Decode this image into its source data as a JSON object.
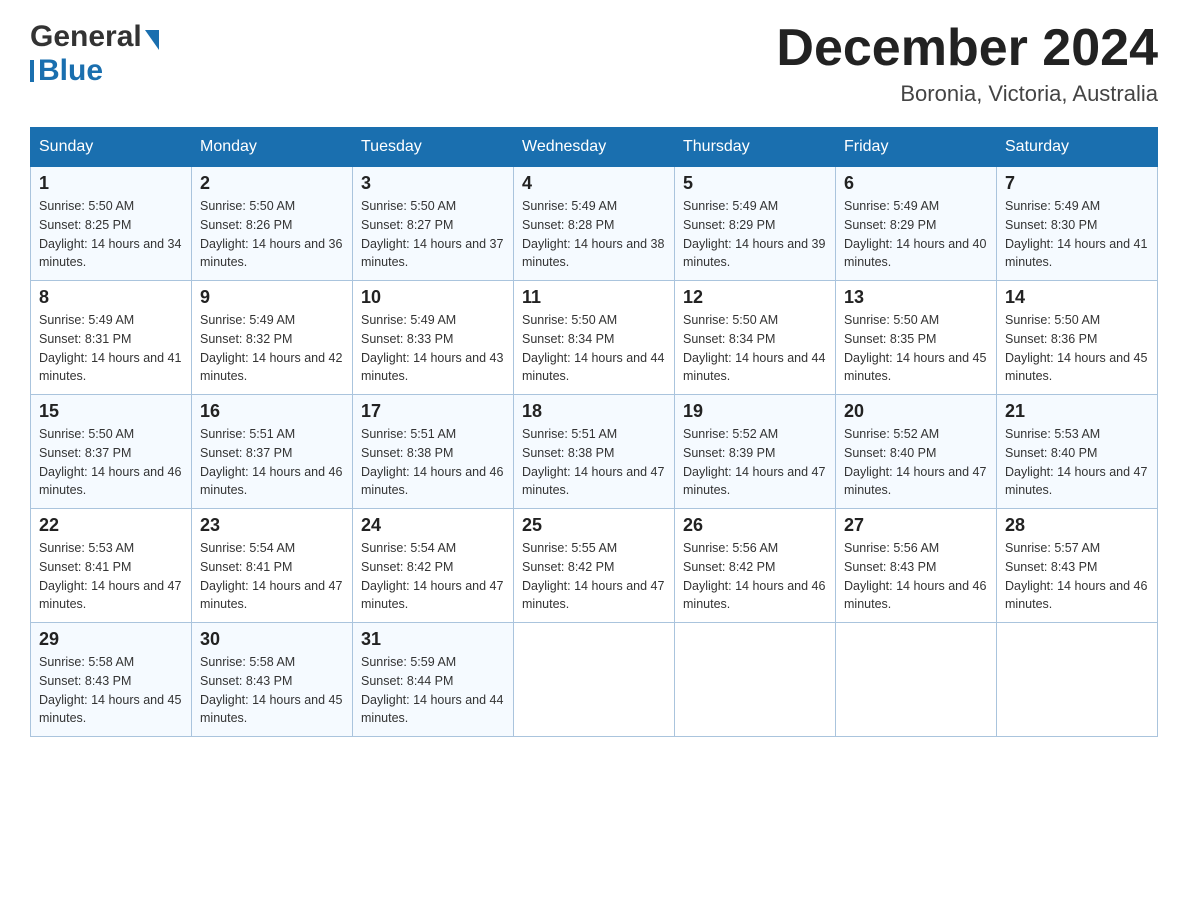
{
  "logo": {
    "text_general": "General",
    "text_blue": "Blue",
    "triangle_color": "#1a6faf"
  },
  "header": {
    "month_year": "December 2024",
    "location": "Boronia, Victoria, Australia"
  },
  "weekdays": [
    "Sunday",
    "Monday",
    "Tuesday",
    "Wednesday",
    "Thursday",
    "Friday",
    "Saturday"
  ],
  "weeks": [
    [
      {
        "day": "1",
        "sunrise": "5:50 AM",
        "sunset": "8:25 PM",
        "daylight": "14 hours and 34 minutes."
      },
      {
        "day": "2",
        "sunrise": "5:50 AM",
        "sunset": "8:26 PM",
        "daylight": "14 hours and 36 minutes."
      },
      {
        "day": "3",
        "sunrise": "5:50 AM",
        "sunset": "8:27 PM",
        "daylight": "14 hours and 37 minutes."
      },
      {
        "day": "4",
        "sunrise": "5:49 AM",
        "sunset": "8:28 PM",
        "daylight": "14 hours and 38 minutes."
      },
      {
        "day": "5",
        "sunrise": "5:49 AM",
        "sunset": "8:29 PM",
        "daylight": "14 hours and 39 minutes."
      },
      {
        "day": "6",
        "sunrise": "5:49 AM",
        "sunset": "8:29 PM",
        "daylight": "14 hours and 40 minutes."
      },
      {
        "day": "7",
        "sunrise": "5:49 AM",
        "sunset": "8:30 PM",
        "daylight": "14 hours and 41 minutes."
      }
    ],
    [
      {
        "day": "8",
        "sunrise": "5:49 AM",
        "sunset": "8:31 PM",
        "daylight": "14 hours and 41 minutes."
      },
      {
        "day": "9",
        "sunrise": "5:49 AM",
        "sunset": "8:32 PM",
        "daylight": "14 hours and 42 minutes."
      },
      {
        "day": "10",
        "sunrise": "5:49 AM",
        "sunset": "8:33 PM",
        "daylight": "14 hours and 43 minutes."
      },
      {
        "day": "11",
        "sunrise": "5:50 AM",
        "sunset": "8:34 PM",
        "daylight": "14 hours and 44 minutes."
      },
      {
        "day": "12",
        "sunrise": "5:50 AM",
        "sunset": "8:34 PM",
        "daylight": "14 hours and 44 minutes."
      },
      {
        "day": "13",
        "sunrise": "5:50 AM",
        "sunset": "8:35 PM",
        "daylight": "14 hours and 45 minutes."
      },
      {
        "day": "14",
        "sunrise": "5:50 AM",
        "sunset": "8:36 PM",
        "daylight": "14 hours and 45 minutes."
      }
    ],
    [
      {
        "day": "15",
        "sunrise": "5:50 AM",
        "sunset": "8:37 PM",
        "daylight": "14 hours and 46 minutes."
      },
      {
        "day": "16",
        "sunrise": "5:51 AM",
        "sunset": "8:37 PM",
        "daylight": "14 hours and 46 minutes."
      },
      {
        "day": "17",
        "sunrise": "5:51 AM",
        "sunset": "8:38 PM",
        "daylight": "14 hours and 46 minutes."
      },
      {
        "day": "18",
        "sunrise": "5:51 AM",
        "sunset": "8:38 PM",
        "daylight": "14 hours and 47 minutes."
      },
      {
        "day": "19",
        "sunrise": "5:52 AM",
        "sunset": "8:39 PM",
        "daylight": "14 hours and 47 minutes."
      },
      {
        "day": "20",
        "sunrise": "5:52 AM",
        "sunset": "8:40 PM",
        "daylight": "14 hours and 47 minutes."
      },
      {
        "day": "21",
        "sunrise": "5:53 AM",
        "sunset": "8:40 PM",
        "daylight": "14 hours and 47 minutes."
      }
    ],
    [
      {
        "day": "22",
        "sunrise": "5:53 AM",
        "sunset": "8:41 PM",
        "daylight": "14 hours and 47 minutes."
      },
      {
        "day": "23",
        "sunrise": "5:54 AM",
        "sunset": "8:41 PM",
        "daylight": "14 hours and 47 minutes."
      },
      {
        "day": "24",
        "sunrise": "5:54 AM",
        "sunset": "8:42 PM",
        "daylight": "14 hours and 47 minutes."
      },
      {
        "day": "25",
        "sunrise": "5:55 AM",
        "sunset": "8:42 PM",
        "daylight": "14 hours and 47 minutes."
      },
      {
        "day": "26",
        "sunrise": "5:56 AM",
        "sunset": "8:42 PM",
        "daylight": "14 hours and 46 minutes."
      },
      {
        "day": "27",
        "sunrise": "5:56 AM",
        "sunset": "8:43 PM",
        "daylight": "14 hours and 46 minutes."
      },
      {
        "day": "28",
        "sunrise": "5:57 AM",
        "sunset": "8:43 PM",
        "daylight": "14 hours and 46 minutes."
      }
    ],
    [
      {
        "day": "29",
        "sunrise": "5:58 AM",
        "sunset": "8:43 PM",
        "daylight": "14 hours and 45 minutes."
      },
      {
        "day": "30",
        "sunrise": "5:58 AM",
        "sunset": "8:43 PM",
        "daylight": "14 hours and 45 minutes."
      },
      {
        "day": "31",
        "sunrise": "5:59 AM",
        "sunset": "8:44 PM",
        "daylight": "14 hours and 44 minutes."
      },
      null,
      null,
      null,
      null
    ]
  ]
}
